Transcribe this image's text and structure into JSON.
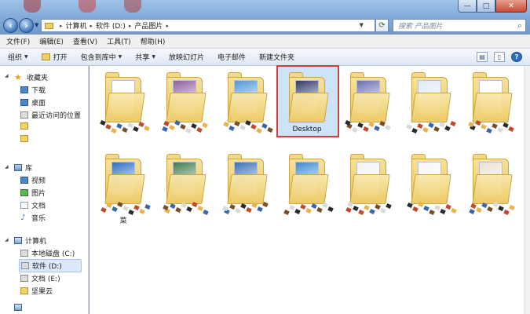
{
  "window": {
    "buttons": {
      "minimize": "—",
      "maximize": "□",
      "close": "✕"
    }
  },
  "address": {
    "crumbs": [
      "计算机",
      "软件 (D:)",
      "产品图片"
    ],
    "search_placeholder": "搜索 产品图片"
  },
  "menu": {
    "items": [
      "文件(F)",
      "编辑(E)",
      "查看(V)",
      "工具(T)",
      "帮助(H)"
    ]
  },
  "toolbar": {
    "organize": "组织",
    "open": "打开",
    "include_in_library": "包含到库中",
    "share": "共享",
    "slideshow": "放映幻灯片",
    "email": "电子邮件",
    "new_folder": "新建文件夹"
  },
  "nav": {
    "favorites": "收藏夹",
    "downloads": "下载",
    "desktop": "桌面",
    "recent": "最近访问的位置",
    "libraries": "库",
    "videos": "视频",
    "pictures": "图片",
    "documents": "文档",
    "music": "音乐",
    "computer": "计算机",
    "local_disk": "本地磁盘 (C:)",
    "software_disk": "软件 (D:)",
    "docs_disk": "文档 (E:)",
    "cloud": "坚果云"
  },
  "folders": [
    {
      "label": ""
    },
    {
      "label": ""
    },
    {
      "label": ""
    },
    {
      "label": "Desktop"
    },
    {
      "label": ""
    },
    {
      "label": ""
    },
    {
      "label": ""
    },
    {
      "label": "菜"
    },
    {
      "label": ""
    },
    {
      "label": ""
    },
    {
      "label": ""
    },
    {
      "label": ""
    },
    {
      "label": ""
    },
    {
      "label": ""
    }
  ],
  "selected_folder": "Desktop",
  "colors": {
    "selection_outline": "#d33d3d",
    "selection_fill": "#cde3f8",
    "folder": "#f2d98a",
    "titlebar": "#7ea7d6"
  },
  "icons": [
    "back-arrow-icon",
    "forward-arrow-icon",
    "refresh-icon",
    "search-icon",
    "star-icon",
    "folder-icon",
    "help-icon"
  ]
}
